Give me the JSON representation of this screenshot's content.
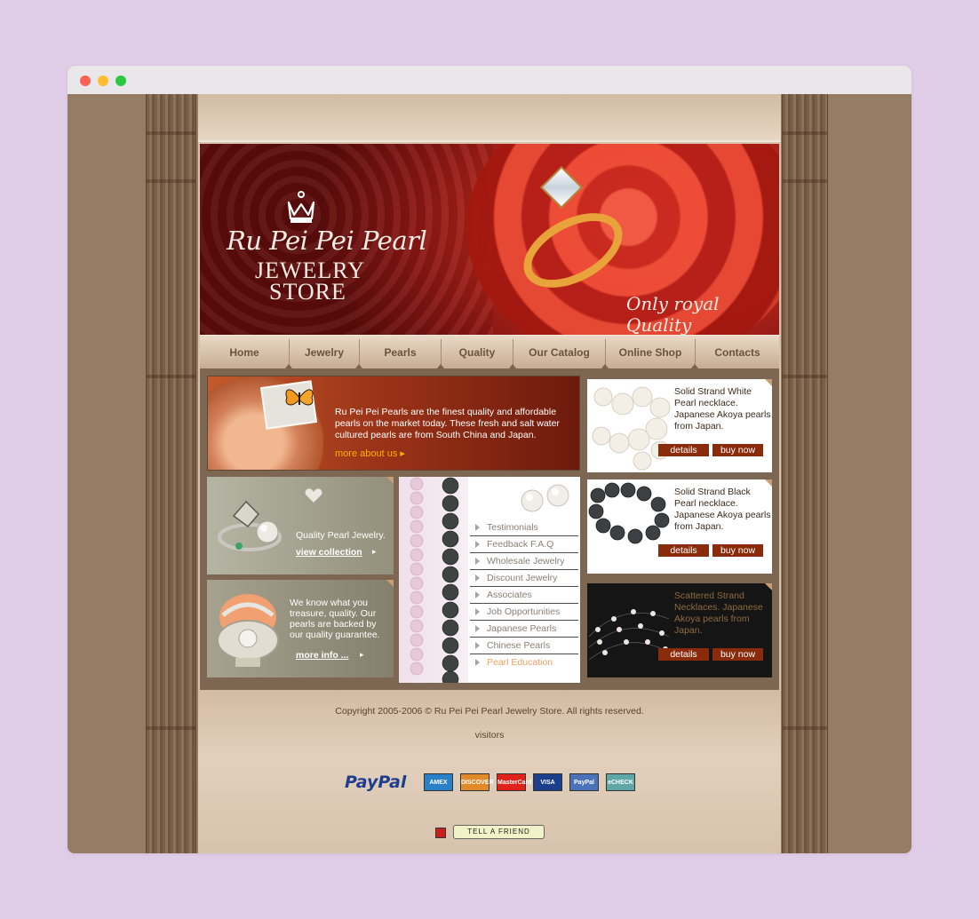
{
  "window": {
    "controls": [
      "close",
      "minimize",
      "maximize"
    ]
  },
  "banner": {
    "brand_script": "Ru Pei Pei Pearl",
    "brand_line2": "JEWELRY",
    "brand_line3": "STORE",
    "slogan": "Only royal Quality",
    "logo_icon": "crown-icon"
  },
  "nav": {
    "items": [
      {
        "label": "Home"
      },
      {
        "label": "Jewelry"
      },
      {
        "label": "Pearls"
      },
      {
        "label": "Quality"
      },
      {
        "label": "Our Catalog"
      },
      {
        "label": "Online Shop"
      },
      {
        "label": "Contacts"
      }
    ]
  },
  "about": {
    "text": "Ru Pei Pei Pearls are the finest quality and affordable pearls on the market today. These fresh and salt water cultured pearls are from South China and Japan.",
    "link": "more about us"
  },
  "promos": [
    {
      "text": "Quality Pearl Jewelry.",
      "link": "view collection"
    },
    {
      "text": "We know what you treasure, quality. Our pearls are backed by our quality guarantee.",
      "link": "more info ..."
    }
  ],
  "links": {
    "items": [
      {
        "label": "Testimonials"
      },
      {
        "label": "Feedback F.A.Q"
      },
      {
        "label": "Wholesale Jewelry"
      },
      {
        "label": "Discount Jewelry"
      },
      {
        "label": "Associates"
      },
      {
        "label": "Job Opportunities"
      },
      {
        "label": "Japanese Pearls"
      },
      {
        "label": "Chinese Pearls"
      },
      {
        "label": "Pearl Education"
      }
    ]
  },
  "products": [
    {
      "text": "Solid Strand White Pearl necklace. Japanese Akoya pearls from Japan.",
      "details": "details",
      "buy": "buy now"
    },
    {
      "text": "Solid Strand Black Pearl necklace. Japanese Akoya pearls from Japan.",
      "details": "details",
      "buy": "buy now"
    },
    {
      "text": "Scattered Strand Necklaces. Japanese Akoya pearls from Japan.",
      "details": "details",
      "buy": "buy now"
    }
  ],
  "footer": {
    "copyright": "Copyright 2005-2006 © Ru Pei Pei Pearl Jewelry Store. All rights reserved.",
    "visitors": "visitors",
    "paypal": "PayPal",
    "cards": [
      {
        "label": "AMEX",
        "color": "#2a7fc9"
      },
      {
        "label": "DISCOVER",
        "color": "#e08a2a"
      },
      {
        "label": "MasterCard",
        "color": "#e0221b"
      },
      {
        "label": "VISA",
        "color": "#1c3f8c"
      },
      {
        "label": "PayPal",
        "color": "#4b72b8"
      },
      {
        "label": "eCHECK",
        "color": "#5fa6a6"
      }
    ],
    "tell_a_friend": "TELL A FRIEND"
  },
  "colors": {
    "accent": "#8a2c0c",
    "link_orange": "#ffb000",
    "active_link": "#f0a060",
    "banner_red": "#c22a1f"
  }
}
